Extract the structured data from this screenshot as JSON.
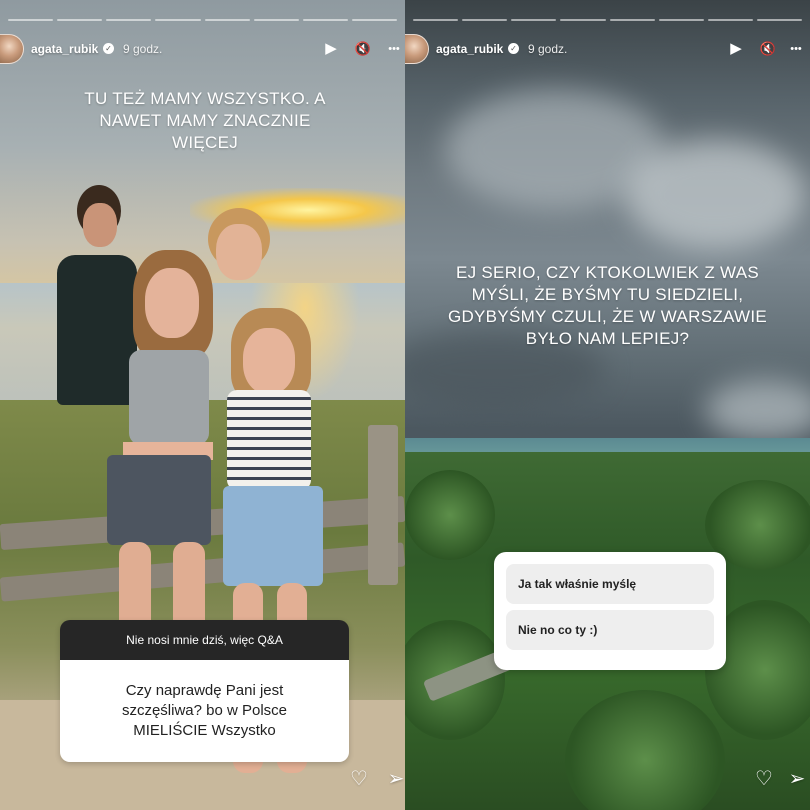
{
  "stories": [
    {
      "progress_segments": 8,
      "username": "agata_rubik",
      "time": "9 godz.",
      "caption": "TU TEŻ MAMY WSZYSTKO. A NAWET MAMY ZNACZNIE WIĘCEJ",
      "qa": {
        "header": "Nie nosi mnie dziś, więc Q&A",
        "question": "Czy naprawdę Pani jest szczęśliwa? bo w Polsce MIELIŚCIE Wszystko"
      }
    },
    {
      "progress_segments": 8,
      "username": "agata_rubik",
      "time": "9 godz.",
      "caption": "EJ SERIO, CZY KTOKOLWIEK Z WAS MYŚLI, ŻE BYŚMY TU SIEDZIELI, GDYBYŚMY CZULI, ŻE W WARSZAWIE BYŁO NAM LEPIEJ?",
      "poll": {
        "options": [
          "Ja tak właśnie myślę",
          "Nie no co ty :)"
        ]
      }
    }
  ],
  "icons": {
    "play": "▶",
    "mute": "🔇",
    "more": "•••",
    "heart": "♡",
    "send": "➢",
    "verified": "✓"
  }
}
